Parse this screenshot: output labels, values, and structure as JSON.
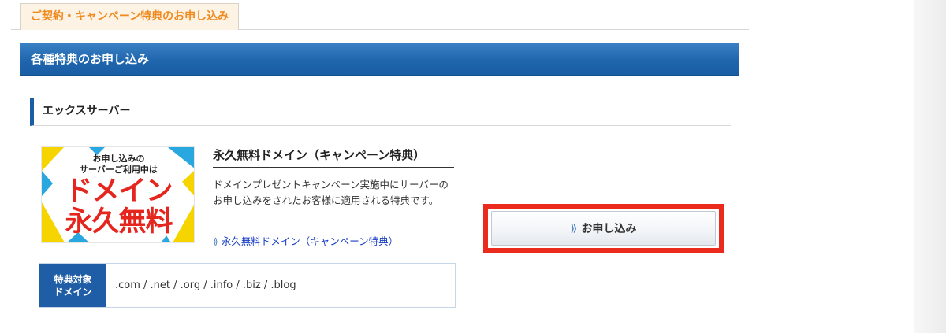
{
  "tab": {
    "label": "ご契約・キャンペーン特典のお申し込み"
  },
  "section": {
    "title": "各種特典のお申し込み"
  },
  "subsection": {
    "title": "エックスサーバー"
  },
  "banner": {
    "line1": "お申し込みの",
    "line2": "サーバーご利用中は",
    "line3": "ドメイン",
    "line4": "永久無料",
    "colors": {
      "text": "#e5261e",
      "accent_yellow": "#f5d400",
      "accent_blue": "#29a8e0"
    }
  },
  "product": {
    "title": "永久無料ドメイン（キャンペーン特典）",
    "description": "ドメインプレゼントキャンペーン実施中にサーバーのお申し込みをされたお客様に適用される特典です。",
    "link_text": "永久無料ドメイン（キャンペーン特典）",
    "link_icon": "double-chevron-right-icon"
  },
  "domains": {
    "label_line1": "特典対象",
    "label_line2": "ドメイン",
    "value": ".com / .net / .org / .info / .biz / .blog"
  },
  "apply_button": {
    "label": "お申し込み",
    "icon": "double-chevron-right-icon",
    "highlight_color": "#ea2a1c"
  },
  "colors": {
    "primary_blue": "#1f66ae",
    "tab_text": "#f08a1e",
    "link": "#1a3fc4"
  }
}
